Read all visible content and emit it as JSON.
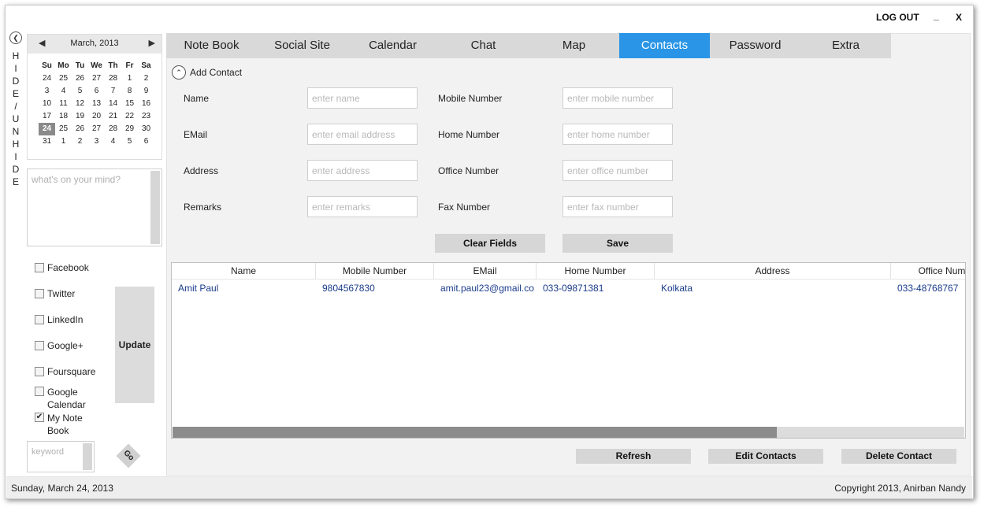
{
  "window": {
    "logout_label": "LOG OUT",
    "minimize_label": "_",
    "close_label": "X"
  },
  "sidebar": {
    "hide_label": "HIDE/UNHIDE",
    "calendar": {
      "month_label": "March, 2013",
      "days_of_week": [
        "Su",
        "Mo",
        "Tu",
        "We",
        "Th",
        "Fr",
        "Sa"
      ],
      "weeks": [
        [
          "24",
          "25",
          "26",
          "27",
          "28",
          "1",
          "2"
        ],
        [
          "3",
          "4",
          "5",
          "6",
          "7",
          "8",
          "9"
        ],
        [
          "10",
          "11",
          "12",
          "13",
          "14",
          "15",
          "16"
        ],
        [
          "17",
          "18",
          "19",
          "20",
          "21",
          "22",
          "23"
        ],
        [
          "24",
          "25",
          "26",
          "27",
          "28",
          "29",
          "30"
        ],
        [
          "31",
          "1",
          "2",
          "3",
          "4",
          "5",
          "6"
        ]
      ],
      "selected_day": "24"
    },
    "mind_placeholder": "what's on your mind?",
    "social": [
      {
        "label": "Facebook",
        "checked": false
      },
      {
        "label": "Twitter",
        "checked": false
      },
      {
        "label": "LinkedIn",
        "checked": false
      },
      {
        "label": "Google+",
        "checked": false
      },
      {
        "label": "Foursquare",
        "checked": false
      },
      {
        "label": "Google Calendar",
        "checked": false
      },
      {
        "label": "My Note Book",
        "checked": true
      }
    ],
    "update_label": "Update",
    "keyword_placeholder": "keyword",
    "go_label": "Go"
  },
  "tabs": [
    {
      "label": "Note Book",
      "active": false
    },
    {
      "label": "Social Site",
      "active": false
    },
    {
      "label": "Calendar",
      "active": false
    },
    {
      "label": "Chat",
      "active": false
    },
    {
      "label": "Map",
      "active": false
    },
    {
      "label": "Contacts",
      "active": true
    },
    {
      "label": "Password",
      "active": false
    },
    {
      "label": "Extra",
      "active": false
    }
  ],
  "contacts": {
    "add_contact_label": "Add Contact",
    "fields_left": [
      {
        "label": "Name",
        "placeholder": "enter name"
      },
      {
        "label": "EMail",
        "placeholder": "enter email address"
      },
      {
        "label": "Address",
        "placeholder": "enter address"
      },
      {
        "label": "Remarks",
        "placeholder": "enter remarks"
      }
    ],
    "fields_right": [
      {
        "label": "Mobile Number",
        "placeholder": "enter mobile number"
      },
      {
        "label": "Home Number",
        "placeholder": "enter home number"
      },
      {
        "label": "Office Number",
        "placeholder": "enter office number"
      },
      {
        "label": "Fax Number",
        "placeholder": "enter fax number"
      }
    ],
    "clear_label": "Clear Fields",
    "save_label": "Save",
    "grid": {
      "columns": [
        "Name",
        "Mobile Number",
        "EMail",
        "Home Number",
        "Address",
        "Office Num"
      ],
      "rows": [
        [
          "Amit Paul",
          "9804567830",
          "amit.paul23@gmail.co",
          "033-09871381",
          "Kolkata",
          "033-48768767"
        ]
      ]
    },
    "refresh_label": "Refresh",
    "edit_label": "Edit Contacts",
    "delete_label": "Delete Contact"
  },
  "status": {
    "date": "Sunday, March 24, 2013",
    "copyright": "Copyright 2013, Anirban Nandy"
  }
}
